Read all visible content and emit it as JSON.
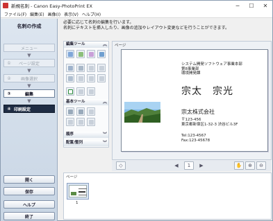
{
  "window": {
    "title": "新規名刺 - Canon Easy-PhotoPrint EX",
    "minimize": "─",
    "maximize": "☐",
    "close": "✕"
  },
  "menu": [
    "ファイル(F)",
    "編集(E)",
    "画像(I)",
    "表示(V)",
    "ヘルプ(H)"
  ],
  "left": {
    "heading": "名刺の作成",
    "steps": [
      {
        "num": "",
        "label": "メニュー",
        "state": "disabled"
      },
      {
        "num": "①",
        "label": "ページ設定",
        "state": "disabled"
      },
      {
        "num": "②",
        "label": "画像選択",
        "state": "disabled"
      },
      {
        "num": "③",
        "label": "編集",
        "state": "active"
      },
      {
        "num": "④",
        "label": "印刷設定",
        "state": "next"
      }
    ],
    "buttons": [
      "開く",
      "保存",
      "ヘルプ",
      "終了"
    ]
  },
  "instructions": {
    "line1": "必要に応じて名刺の編集を行います。",
    "line2": "名刺にテキストを挿入したり、画像の追加やレイアウト変更などを行うことができます。"
  },
  "tools": {
    "edit_tools_title": "編集ツール",
    "basic_tools_title": "基本ツール",
    "order_title": "順序",
    "arrange_title": "配置/整列"
  },
  "page": {
    "label": "ページ",
    "card": {
      "dept1": "システム開発ソフトウェア事業本部",
      "dept2": "第8事業部",
      "dept3": "環境開発課",
      "name": "宗太　宗光",
      "company": "宗太株式会社",
      "postal": "〒123-456",
      "address": "東京都新宿区1-32-3 渋谷ビル3F",
      "tel": "Tel:123-4567",
      "fax": "Fax:123-45678"
    },
    "page_number": "1"
  },
  "thumbnails": {
    "label": "ページ",
    "items": [
      {
        "number": "1"
      }
    ]
  }
}
